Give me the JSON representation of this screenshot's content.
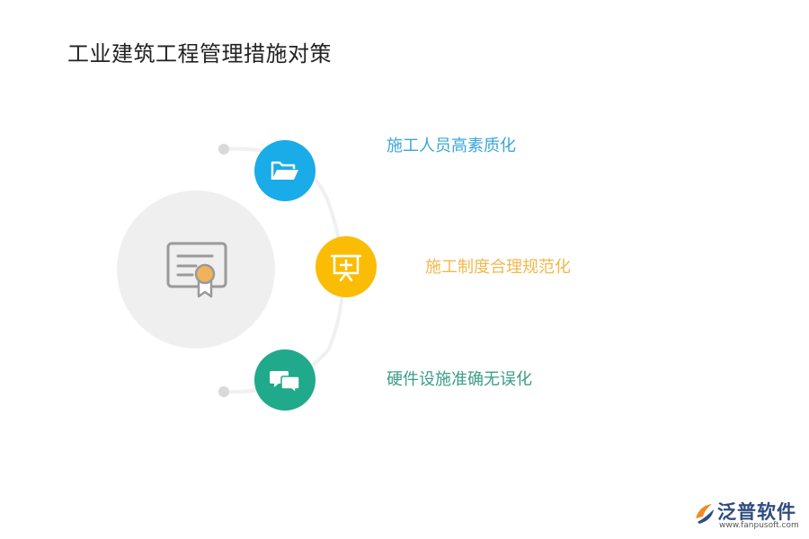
{
  "title": "工业建筑工程管理措施对策",
  "nodes": [
    {
      "label": "施工人员高素质化",
      "color": "#1aabe9",
      "icon": "folder-icon"
    },
    {
      "label": "施工制度合理规范化",
      "color": "#fbbc05",
      "icon": "presentation-board-icon"
    },
    {
      "label": "硬件设施准确无误化",
      "color": "#20a98a",
      "icon": "chat-bubbles-icon"
    }
  ],
  "center_icon": "certificate-icon",
  "colors": {
    "center_circle": "#efefef",
    "arc": "#f0f0f0",
    "dot": "#d9d9d9",
    "icon_gray": "#9a9a9a",
    "medal": "#f0b35b"
  },
  "logo": {
    "name": "泛普软件",
    "url": "www.fanpusoft.com"
  }
}
